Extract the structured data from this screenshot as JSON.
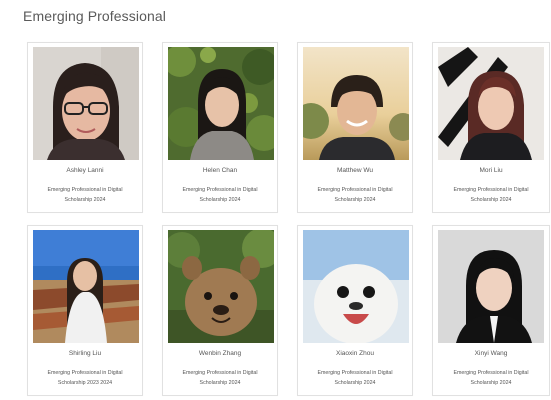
{
  "section": {
    "title": "Emerging Professional"
  },
  "profiles": [
    {
      "name": "Ashley Lanni",
      "role": "Emerging Professional in Digital Scholarship 2024"
    },
    {
      "name": "Helen Chan",
      "role": "Emerging Professional in Digital Scholarship 2024"
    },
    {
      "name": "Matthew Wu",
      "role": "Emerging Professional in Digital Scholarship 2024"
    },
    {
      "name": "Mori Liu",
      "role": "Emerging Professional in Digital Scholarship 2024"
    },
    {
      "name": "Shirling Liu",
      "role": "Emerging Professional in Digital Scholarship 2023 2024"
    },
    {
      "name": "Wenbin Zhang",
      "role": "Emerging Professional in Digital Scholarship 2024"
    },
    {
      "name": "Xiaoxin Zhou",
      "role": "Emerging Professional in Digital Scholarship 2024"
    },
    {
      "name": "Xinyi Wang",
      "role": "Emerging Professional in Digital Scholarship 2024"
    }
  ]
}
